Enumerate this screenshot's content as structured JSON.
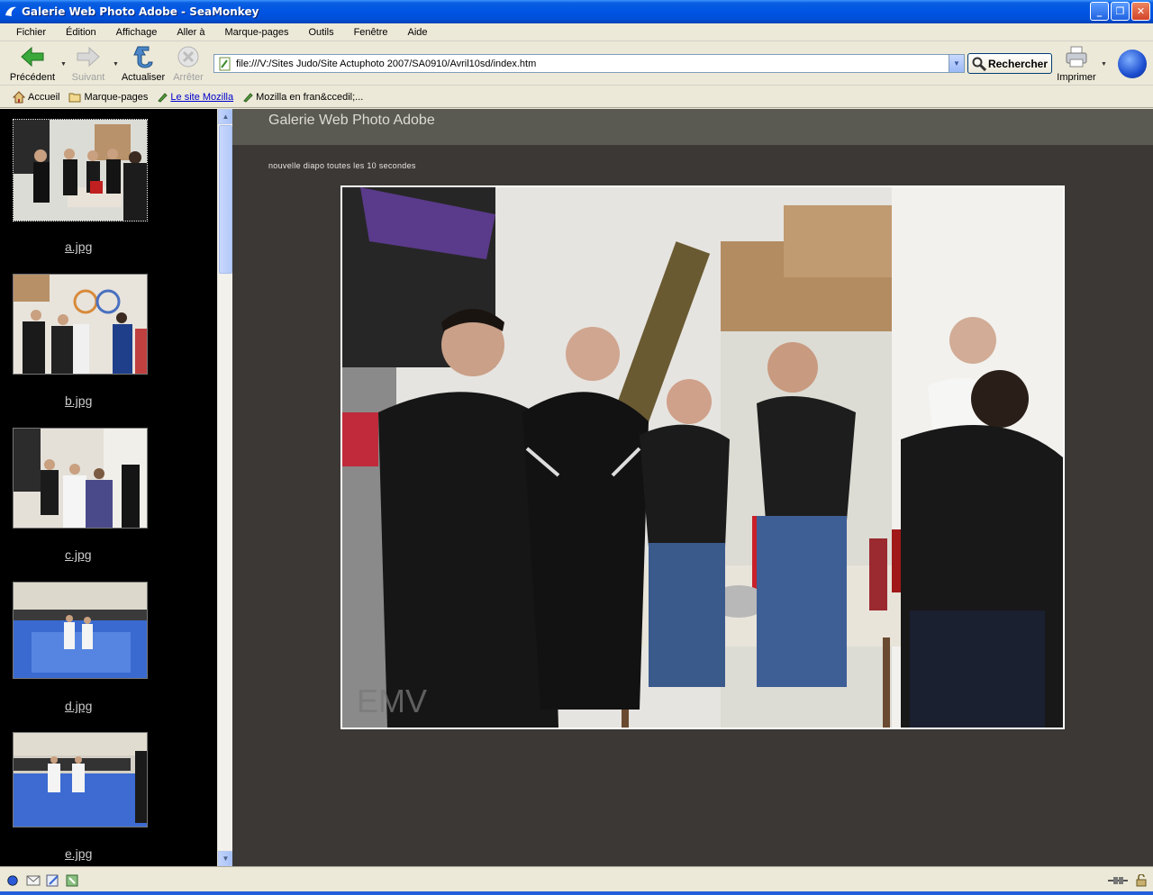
{
  "window": {
    "title": "Galerie Web Photo Adobe - SeaMonkey"
  },
  "menu": [
    "Fichier",
    "Édition",
    "Affichage",
    "Aller à",
    "Marque-pages",
    "Outils",
    "Fenêtre",
    "Aide"
  ],
  "toolbar": {
    "back_label": "Précédent",
    "forward_label": "Suivant",
    "reload_label": "Actualiser",
    "stop_label": "Arrêter",
    "url": "file:///V:/Sites  Judo/Site Actuphoto 2007/SA0910/Avril10sd/index.htm",
    "search_label": "Rechercher",
    "print_label": "Imprimer"
  },
  "bookmarks": [
    "Accueil",
    "Marque-pages",
    "Le site Mozilla",
    "Mozilla en fran&ccedil;..."
  ],
  "gallery": {
    "title": "Galerie Web Photo Adobe",
    "subtitle": "nouvelle diapo toutes les 10 secondes",
    "watermark": "EMV",
    "thumbnails": [
      "a.jpg",
      "b.jpg",
      "c.jpg",
      "d.jpg",
      "e.jpg"
    ]
  },
  "colors": {
    "content_bg": "#3b3835",
    "header_band": "#5b5a52",
    "sidebar_bg": "#000000",
    "titlebar": "#0054e3"
  }
}
